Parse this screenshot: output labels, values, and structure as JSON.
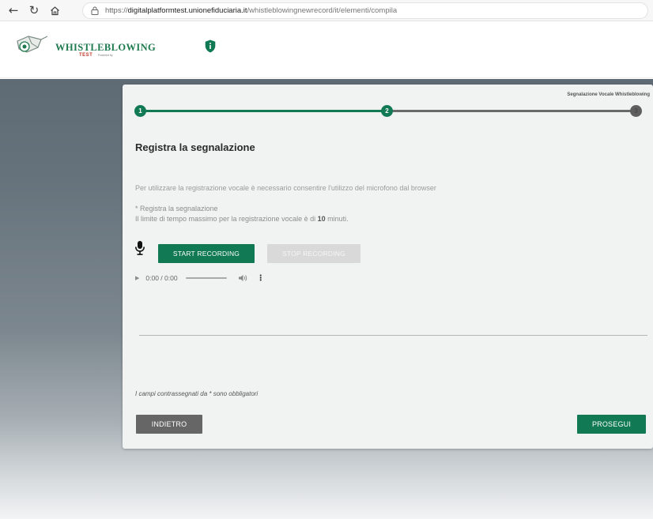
{
  "browser": {
    "url_scheme": "https://",
    "url_domain": "digitalplatformtest.unionefiduciaria.it",
    "url_path": "/whistleblowingnewrecord/it/elementi/compila"
  },
  "header": {
    "brand_name": "WHISTLEBLOWING",
    "brand_env": "TEST",
    "powered_by": "Powered by ",
    "shield_icon": "shield-info-icon"
  },
  "stepper": {
    "title": "Segnalazione Vocale Whistleblowing",
    "steps": [
      {
        "number": "1",
        "state": "done"
      },
      {
        "number": "2",
        "state": "current"
      },
      {
        "number": "3",
        "state": "todo"
      }
    ]
  },
  "form": {
    "section_title": "Registra la segnalazione",
    "info_text": "Per utilizzare la registrazione vocale è necessario consentire l'utilizzo del microfono dal browser",
    "required_label": "* Registra la segnalazione",
    "limit_prefix": "Il limite di tempo massimo per la registrazione vocale è di ",
    "limit_value": "10",
    "limit_suffix": " minuti.",
    "start_label": "START RECORDING",
    "stop_label": "STOP RECORDING",
    "player_time": "0:00 / 0:00",
    "mandatory_note": "I campi contrassegnati da * sono obbligatori"
  },
  "actions": {
    "back_label": "INDIETRO",
    "next_label": "PROSEGUI"
  },
  "colors": {
    "primary_green": "#117a55",
    "disabled_gray": "#d9d9d9",
    "back_gray": "#666666"
  }
}
